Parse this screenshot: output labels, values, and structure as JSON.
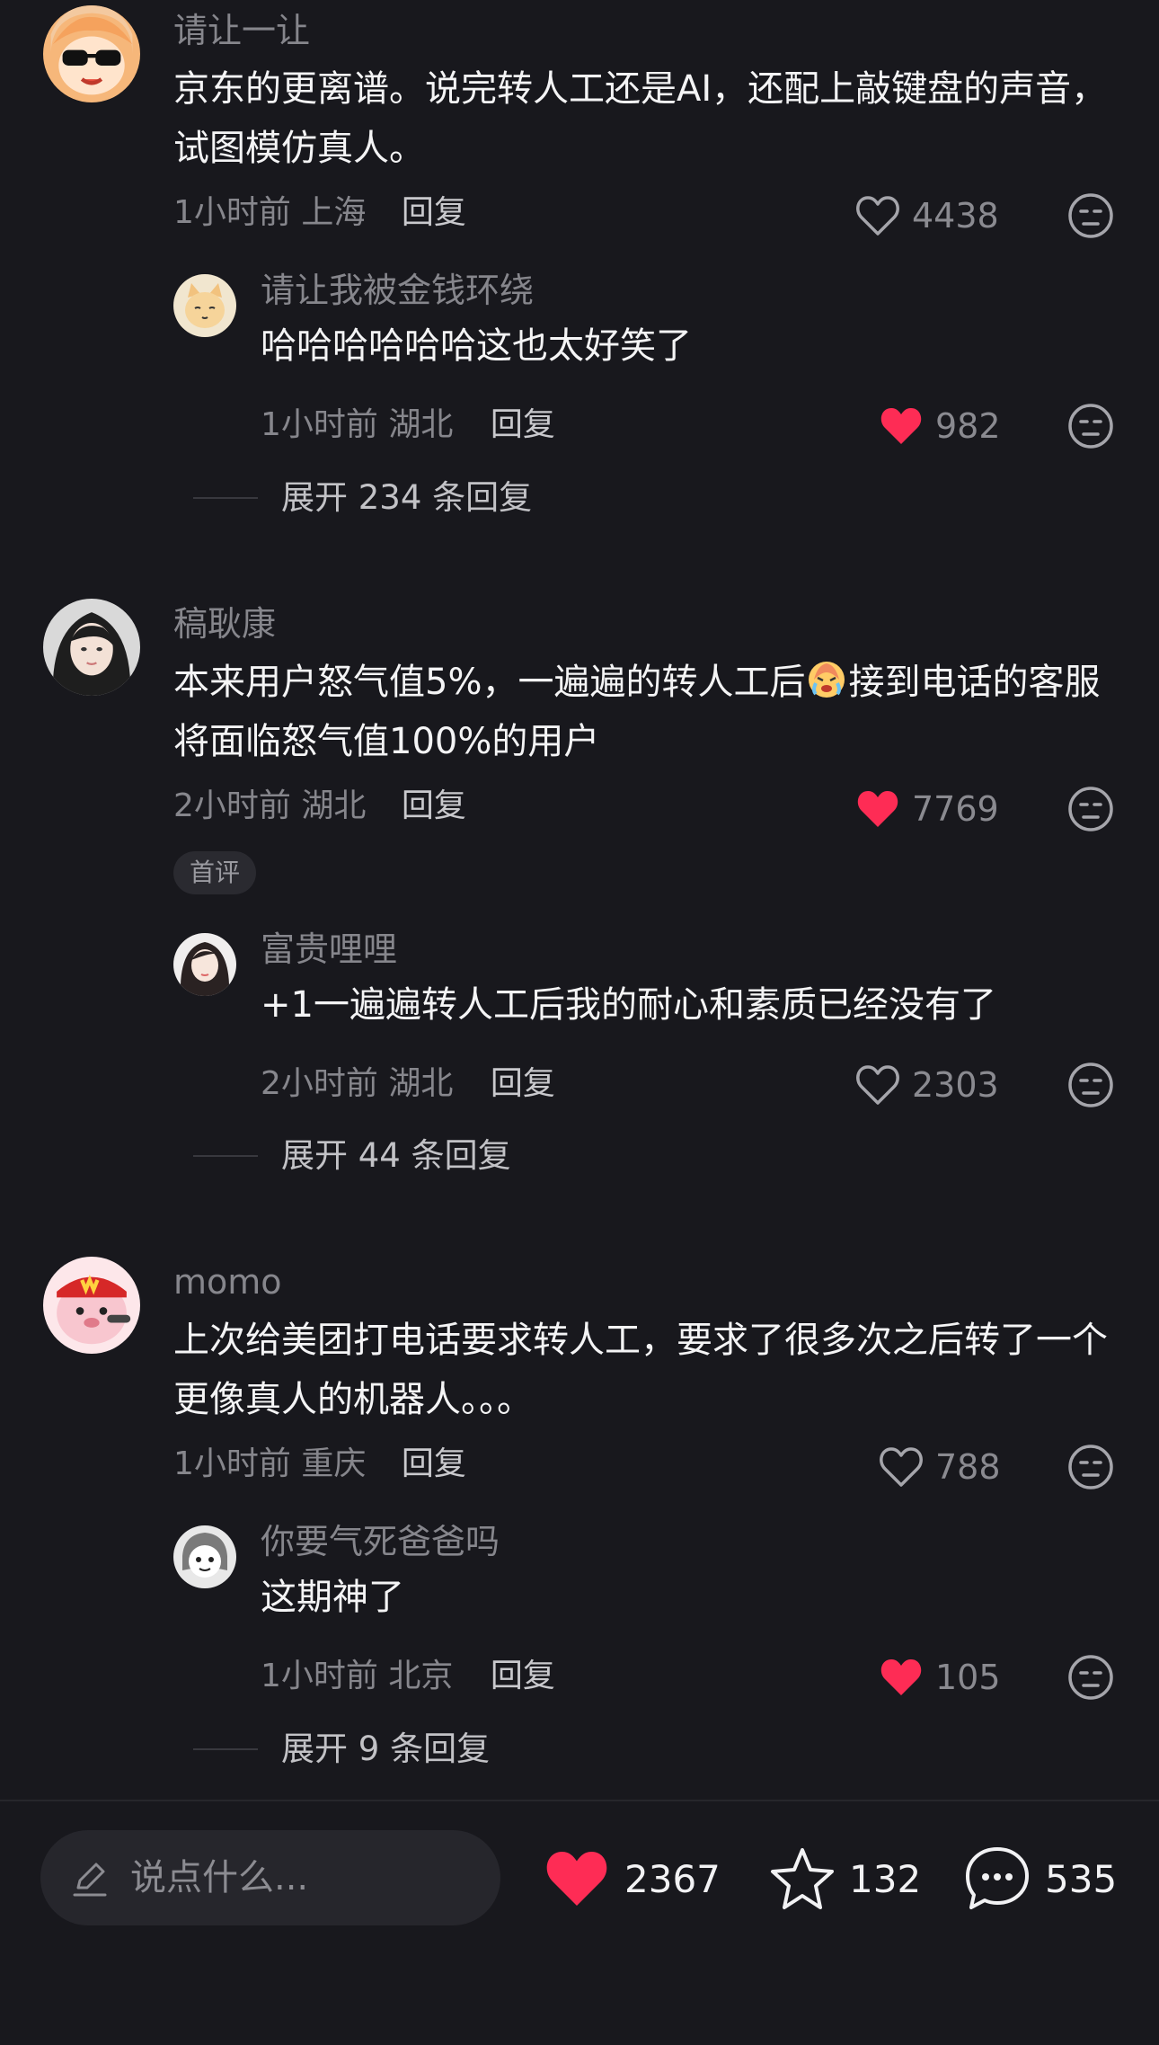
{
  "comments": [
    {
      "username": "请让一让",
      "text": "京东的更离谱。说完转人工还是AI，还配上敲键盘的声音，试图模仿真人。",
      "time": "1小时前",
      "location": "上海",
      "reply_label": "回复",
      "likes": "4438",
      "liked": false,
      "badge": "",
      "reply": {
        "username": "请让我被金钱环绕",
        "text": "哈哈哈哈哈哈这也太好笑了",
        "time": "1小时前",
        "location": "湖北",
        "reply_label": "回复",
        "likes": "982",
        "liked": true
      },
      "expand_label": "展开 234 条回复"
    },
    {
      "username": "稿耿康",
      "text_before_emoji": "本来用户怒气值5%，一遍遍的转人工后",
      "text_after_emoji": "接到电话的客服将面临怒气值100%的用户",
      "emoji": "crying-face-icon",
      "time": "2小时前",
      "location": "湖北",
      "reply_label": "回复",
      "likes": "7769",
      "liked": true,
      "badge": "首评",
      "reply": {
        "username": "富贵哩哩",
        "text": "+1一遍遍转人工后我的耐心和素质已经没有了",
        "time": "2小时前",
        "location": "湖北",
        "reply_label": "回复",
        "likes": "2303",
        "liked": false
      },
      "expand_label": "展开 44 条回复"
    },
    {
      "username": "momo",
      "text": "上次给美团打电话要求转人工，要求了很多次之后转了一个更像真人的机器人。。。",
      "time": "1小时前",
      "location": "重庆",
      "reply_label": "回复",
      "likes": "788",
      "liked": false,
      "badge": "",
      "reply": {
        "username": "你要气死爸爸吗",
        "text": "这期神了",
        "time": "1小时前",
        "location": "北京",
        "reply_label": "回复",
        "likes": "105",
        "liked": true
      },
      "expand_label": "展开 9 条回复"
    }
  ],
  "bottom_bar": {
    "input_placeholder": "说点什么...",
    "likes": "2367",
    "favorites": "132",
    "comments": "535"
  },
  "colors": {
    "background": "#18181d",
    "like_red": "#fe2c55",
    "muted_text": "#86868c"
  }
}
